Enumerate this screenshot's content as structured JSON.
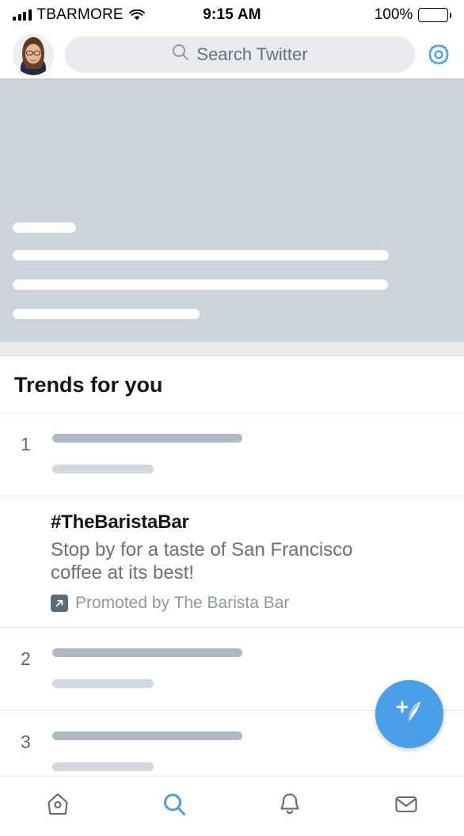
{
  "status_bar": {
    "carrier": "TBARMORE",
    "time": "9:15 AM",
    "battery_percent": "100%",
    "signal_icon": "cellular-signal-icon",
    "wifi_icon": "wifi-icon",
    "battery_icon": "battery-full-icon"
  },
  "header": {
    "avatar_name": "profile-avatar",
    "search_placeholder": "Search Twitter",
    "search_icon": "search-icon",
    "settings_icon": "gear-icon"
  },
  "hero": {
    "label": "loading-placeholder"
  },
  "trends": {
    "title": "Trends for you",
    "items": [
      {
        "rank": "1"
      },
      {
        "rank": "2"
      },
      {
        "rank": "3"
      }
    ]
  },
  "promoted": {
    "hashtag": "#TheBaristaBar",
    "description": "Stop by for a taste of San Francisco coffee at its best!",
    "promoted_by": "Promoted by The Barista Bar",
    "promoted_icon": "arrow-up-right-icon"
  },
  "compose": {
    "label": "compose-tweet",
    "icon": "feather-plus-icon"
  },
  "bottom_nav": {
    "items": [
      {
        "name": "home",
        "icon": "home-icon",
        "active": false
      },
      {
        "name": "search",
        "icon": "search-icon",
        "active": true
      },
      {
        "name": "notifications",
        "icon": "bell-icon",
        "active": false
      },
      {
        "name": "messages",
        "icon": "envelope-icon",
        "active": false
      }
    ]
  },
  "colors": {
    "accent": "#4a9eea",
    "text_primary": "#14171a",
    "text_secondary": "#65727f",
    "text_muted": "#8b98a5",
    "skeleton_dark": "#aeb9c4",
    "skeleton_light": "#d2d8de",
    "hero_bg": "#ccd3da",
    "search_bg": "#e8ebed",
    "divider": "#e6ecf0",
    "nav_inactive": "#5b6b7c"
  }
}
